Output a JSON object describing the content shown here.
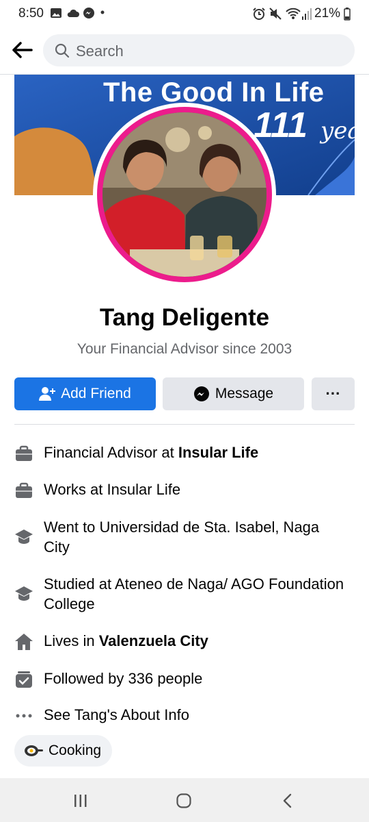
{
  "status": {
    "time": "8:50",
    "battery": "21%"
  },
  "search": {
    "placeholder": "Search"
  },
  "cover": {
    "title": "The Good In Life",
    "number": "111",
    "years": "yea"
  },
  "profile": {
    "name": "Tang Deligente",
    "bio": "Your Financial Advisor since 2003"
  },
  "actions": {
    "add_friend": "Add Friend",
    "message": "Message",
    "more": "···"
  },
  "info": [
    {
      "icon": "briefcase-icon",
      "prefix": "Financial Advisor at ",
      "bold": "Insular Life"
    },
    {
      "icon": "briefcase-icon",
      "prefix": "Works at Insular Life",
      "bold": ""
    },
    {
      "icon": "graduation-cap-icon",
      "prefix": "Went to Universidad de Sta. Isabel, Naga City",
      "bold": ""
    },
    {
      "icon": "graduation-cap-icon",
      "prefix": "Studied at Ateneo de  Naga/ AGO Foundation  College",
      "bold": ""
    },
    {
      "icon": "home-icon",
      "prefix": "Lives in ",
      "bold": "Valenzuela City"
    },
    {
      "icon": "followers-icon",
      "prefix": "Followed by 336 people",
      "bold": ""
    },
    {
      "icon": "more-dots-icon",
      "prefix": "See Tang's About Info",
      "bold": ""
    }
  ],
  "interest_chip": {
    "icon": "cooking-icon",
    "label": "Cooking"
  },
  "colors": {
    "accent": "#1b74e4",
    "avatar_ring": "#ec1c8c",
    "cover_bg": "#1f5bb5"
  }
}
